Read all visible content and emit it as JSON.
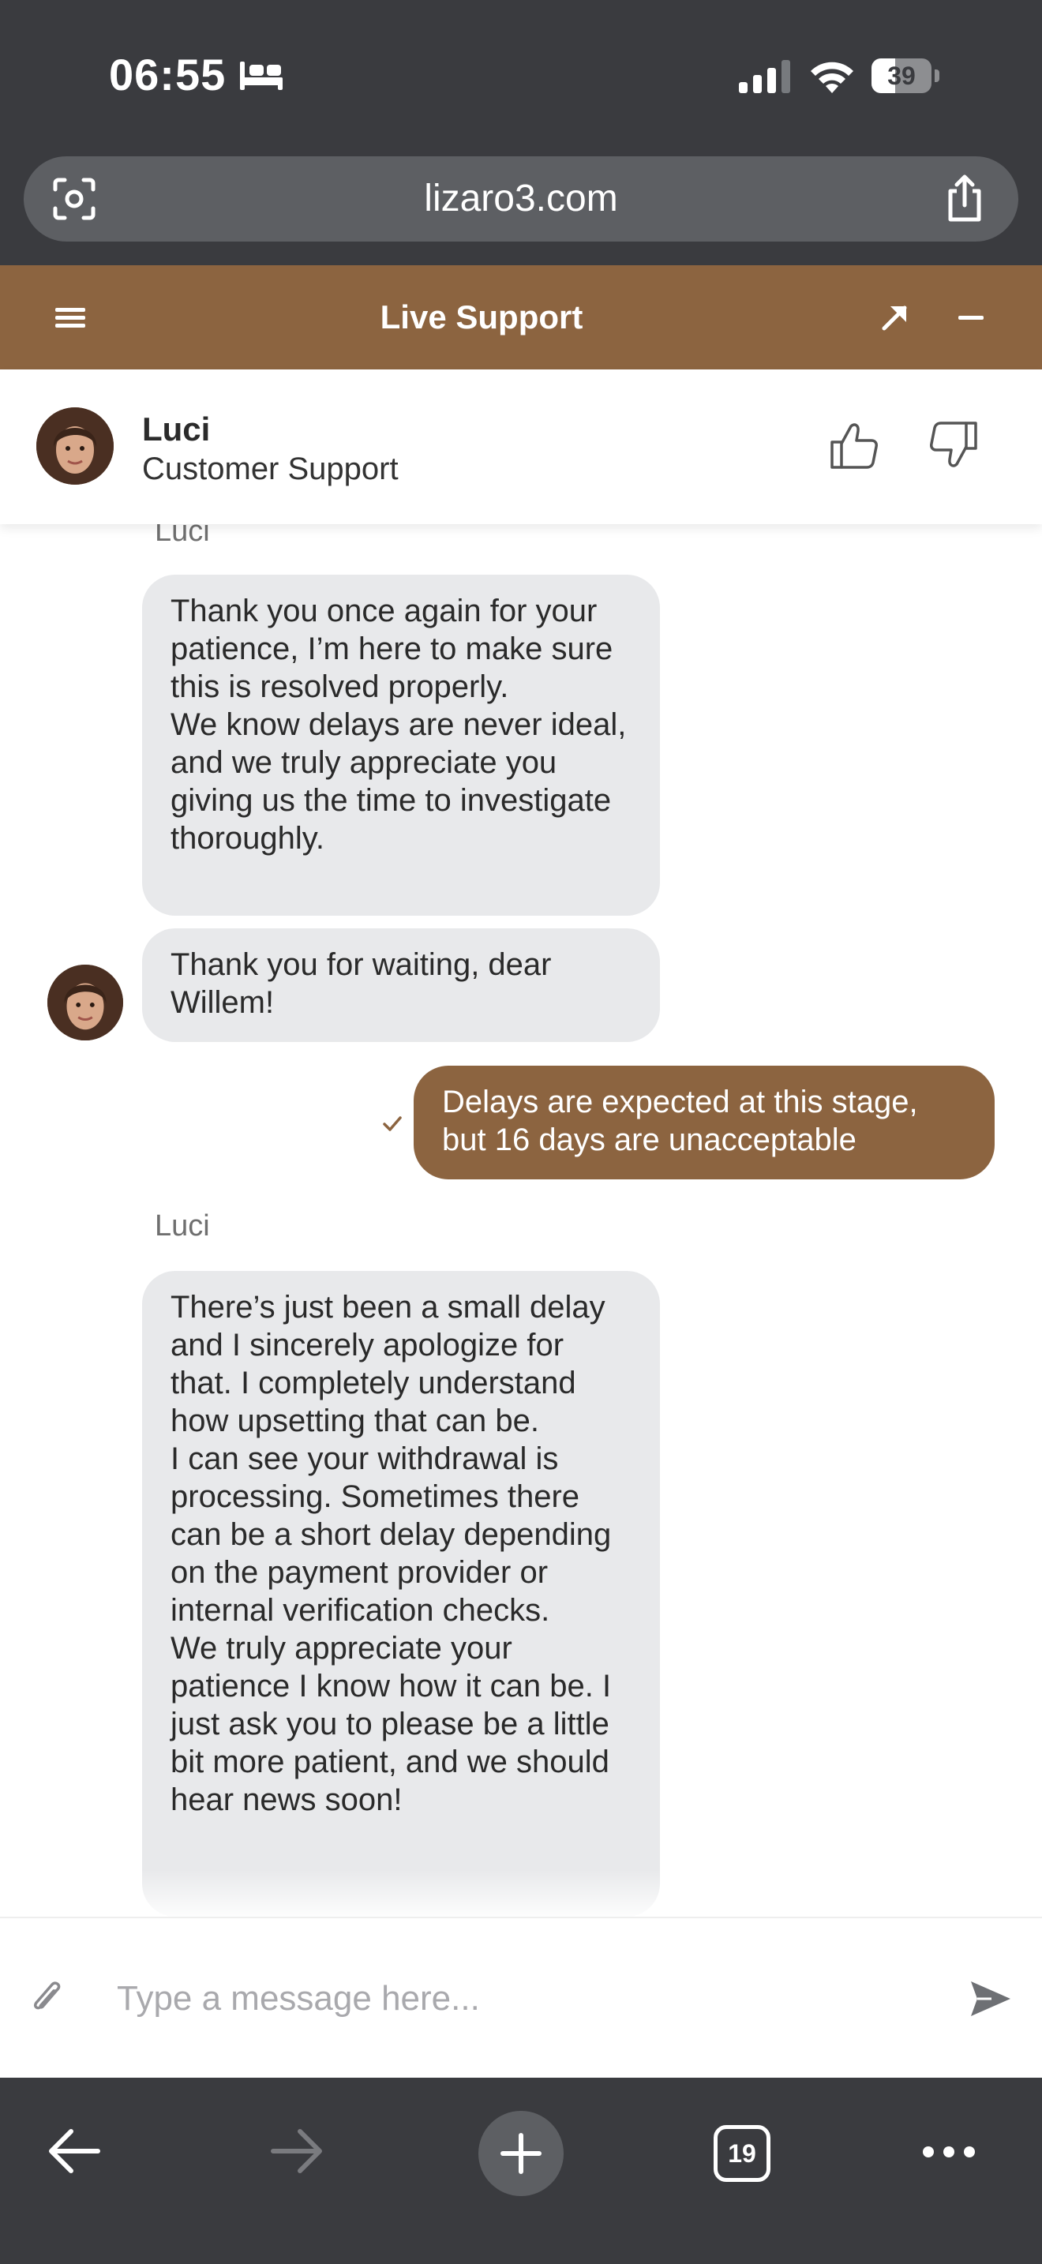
{
  "status_bar": {
    "time": "06:55",
    "battery_level": "39",
    "battery_fraction": 0.39
  },
  "browser": {
    "url": "lizaro3.com",
    "tab_count": "19"
  },
  "widget": {
    "title": "Live Support",
    "accent_color": "#8c6440"
  },
  "agent": {
    "name": "Luci",
    "role": "Customer Support"
  },
  "messages": [
    {
      "sender": "agent",
      "label": "Luci",
      "text": "Thank you once again for your patience, I’m here to make sure this is resolved properly.\nWe know delays are never ideal, and we truly appreciate you giving us the time to investigate thoroughly."
    },
    {
      "sender": "agent",
      "text": "Thank you for waiting, dear Willem!"
    },
    {
      "sender": "user",
      "text": "Delays are expected at this stage, but 16 days are unacceptable"
    },
    {
      "sender": "agent",
      "label": "Luci",
      "text": "There’s just been a small delay and I sincerely apologize for that. I completely understand how upsetting that can be.\n I can see your withdrawal is processing. Sometimes there can be a short delay depending on the payment provider or internal verification checks.\nWe truly appreciate your patience  I know how it can be. I just ask you to please be a little bit more patient, and we should hear news soon!"
    }
  ],
  "composer": {
    "placeholder": "Type a message here..."
  },
  "icons": {
    "status": [
      "bed-icon",
      "signal-icon",
      "wifi-icon",
      "battery-icon"
    ],
    "header": [
      "menu-icon",
      "expand-icon",
      "minimize-icon"
    ],
    "agent": [
      "thumbs-up-icon",
      "thumbs-down-icon"
    ],
    "composer": [
      "paperclip-icon",
      "send-icon"
    ],
    "toolbar": [
      "back-arrow-icon",
      "forward-arrow-icon",
      "plus-icon",
      "tabs-icon",
      "more-icon"
    ]
  }
}
